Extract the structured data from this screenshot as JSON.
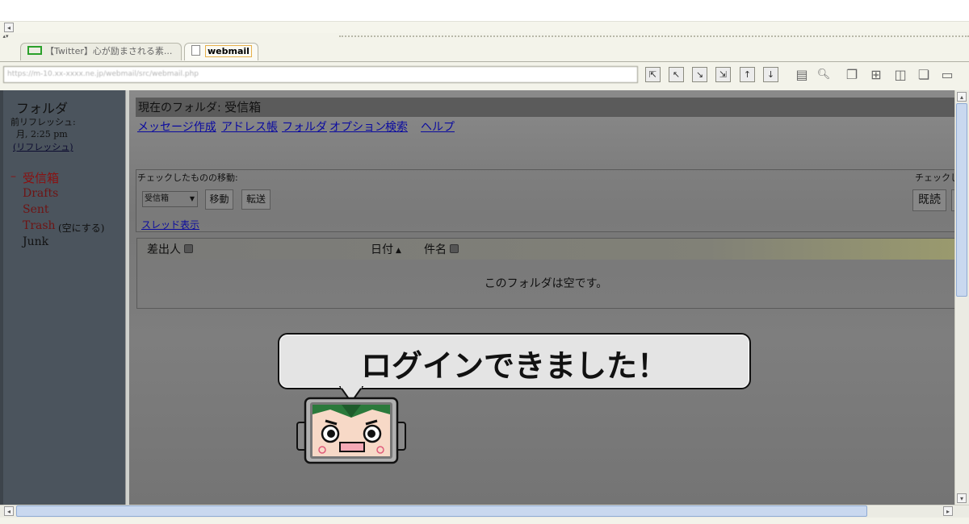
{
  "browser": {
    "tabs": [
      {
        "label": "【Twitter】心が励まされる素...",
        "active": false
      },
      {
        "label": "webmail",
        "active": true
      }
    ],
    "address": "https://m-10.xx-xxxx.ne.jp/webmail/src/webmail.php",
    "toolbar_icons": [
      "back-all-icon",
      "back-icon",
      "forward-icon",
      "forward-all-icon",
      "up-icon",
      "down-icon",
      "page-icon",
      "search-icon",
      "window-icon",
      "new-window-icon",
      "duplicate-window-icon",
      "cascade-windows-icon",
      "minimize-window-icon"
    ]
  },
  "sidebar": {
    "title": "フォルダ",
    "last_refresh_label": "前リフレッシュ:",
    "last_refresh_time": "月, 2:25 pm",
    "refresh_link": "(リフレッシュ)",
    "collapse_marker": "–",
    "folders": [
      {
        "name": "受信箱",
        "color": "#8b1010"
      },
      {
        "name": "Drafts",
        "color": "#6e1414"
      },
      {
        "name": "Sent",
        "color": "#6e1414"
      },
      {
        "name": "Trash",
        "color": "#6e1414",
        "action": "(空にする)"
      },
      {
        "name": "Junk",
        "color": "#111111"
      }
    ]
  },
  "main": {
    "current_folder_label": "現在のフォルダ:",
    "current_folder_name": "受信箱",
    "nav_links": [
      "メッセージ作成",
      "アドレス帳",
      "フォルダ",
      "オプション",
      "検索",
      "ヘルプ"
    ],
    "move_label": "チェックしたものの移動:",
    "move_select_value": "受信箱",
    "move_button": "移動",
    "forward_button": "転送",
    "right_label": "チェックした",
    "read_button": "既読",
    "thread_link": "スレッド表示",
    "columns": {
      "from": "差出人",
      "date": "日付",
      "subject": "件名"
    },
    "empty_message": "このフォルダは空です。"
  },
  "overlay": {
    "bubble_text": "ログインできました！"
  }
}
